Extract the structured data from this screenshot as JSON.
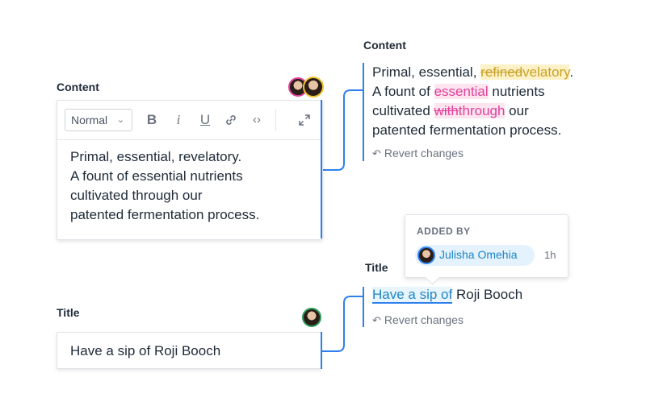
{
  "content_editor": {
    "label": "Content",
    "format_select": {
      "value": "Normal"
    },
    "toolbar": {
      "bold": "B",
      "italic": "i",
      "underline": "U",
      "link_icon": "link-icon",
      "code_icon": "code-icon",
      "expand_icon": "expand-icon"
    },
    "lines": [
      "Primal, essential, revelatory.",
      "A fount of essential nutrients",
      "cultivated through our",
      "patented fermentation process."
    ],
    "avatars": [
      "avatar-pink",
      "avatar-yellow"
    ]
  },
  "title_editor": {
    "label": "Title",
    "value": "Have a sip of Roji Booch",
    "avatars": [
      "avatar-green"
    ]
  },
  "content_diff": {
    "label": "Content",
    "l1_plain": "Primal, essential, ",
    "l1_del": "refined",
    "l1_add": "velatory",
    "l1_end": ".",
    "l2_pre": "A fount of ",
    "l2_hl": "essential",
    "l2_post": " nutrients",
    "l3_pre": "cultivated ",
    "l3_del": "with",
    "l3_add": "through",
    "l3_post": " our",
    "l4": "patented fermentation process.",
    "revert": "Revert changes",
    "revert_icon": "undo-icon"
  },
  "title_diff": {
    "label": "Title",
    "added": "Have a sip of",
    "rest": " Roji Booch",
    "revert": "Revert changes",
    "revert_icon": "undo-icon"
  },
  "tooltip": {
    "heading": "ADDED BY",
    "user": "Julisha Omehia",
    "time": "1h"
  },
  "colors": {
    "accent_blue": "#2f80ed",
    "insert_yellow": "#c9a227",
    "insert_pink": "#e0409a",
    "insert_blue": "#1f86c7"
  }
}
